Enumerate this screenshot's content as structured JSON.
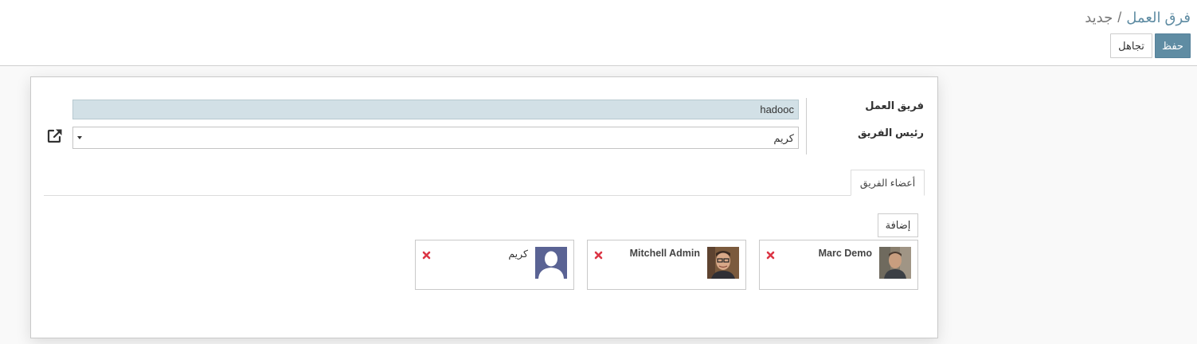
{
  "breadcrumb": {
    "parent": "فرق العمل",
    "separator": "/",
    "current": "جديد"
  },
  "buttons": {
    "save": "حفظ",
    "discard": "تجاهل"
  },
  "form": {
    "team_name_label": "فريق العمل",
    "team_name_value": "hadooc",
    "team_leader_label": "رئيس الفريق",
    "team_leader_value": "كريم"
  },
  "tabs": [
    {
      "label": "أعضاء الفريق",
      "active": true
    }
  ],
  "members": {
    "add_label": "إضافة",
    "items": [
      {
        "name": "Marc Demo",
        "avatar": "photo-marc"
      },
      {
        "name": "Mitchell Admin",
        "avatar": "photo-mitchell"
      },
      {
        "name": "كريم",
        "avatar": "placeholder-silhouette"
      }
    ]
  },
  "colors": {
    "primary": "#5f8ca3",
    "input_highlight": "#d2e0e6",
    "remove": "#dc3545"
  },
  "icons": {
    "external_link": "external-link-icon",
    "remove": "remove-icon",
    "caret": "caret-down-icon"
  }
}
